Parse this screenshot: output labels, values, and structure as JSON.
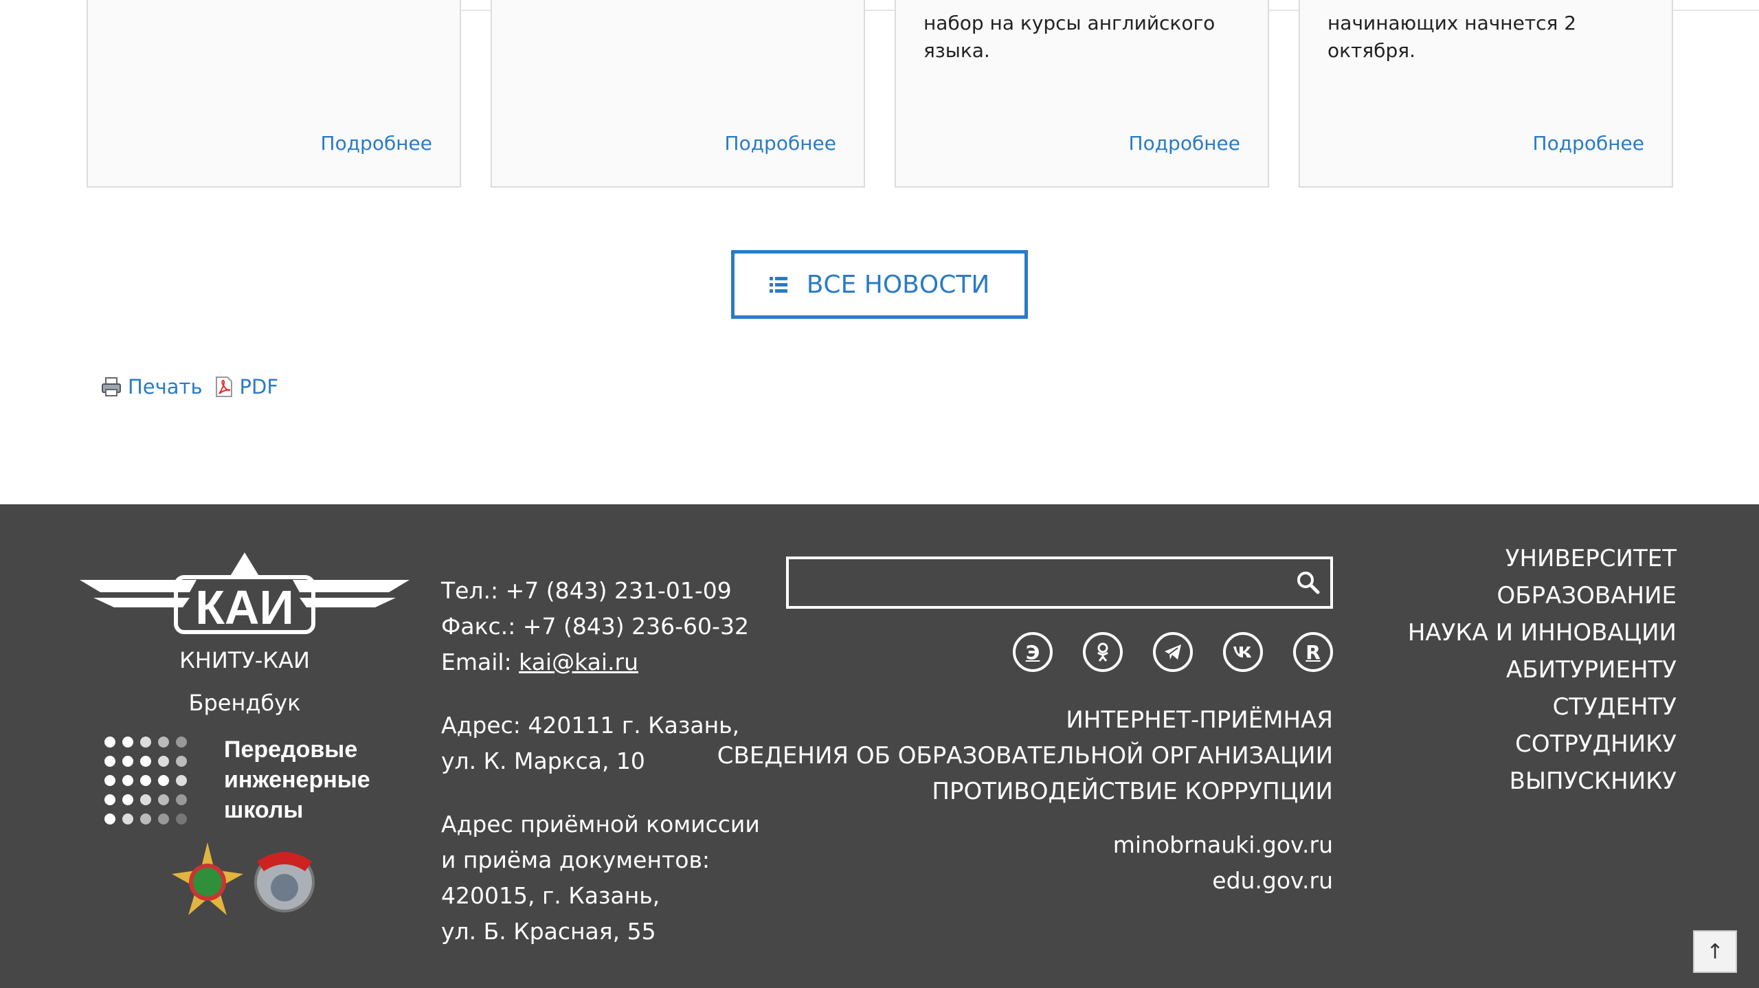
{
  "news": [
    {
      "excerpt": "",
      "more": "Подробнее"
    },
    {
      "excerpt": "",
      "more": "Подробнее"
    },
    {
      "excerpt": "набор на курсы английского языка.",
      "more": "Подробнее"
    },
    {
      "excerpt": "начинающих начнется 2 октября.",
      "more": "Подробнее"
    }
  ],
  "all_news_label": "ВСЕ НОВОСТИ",
  "print": {
    "print_label": "Печать",
    "pdf_label": "PDF"
  },
  "footer": {
    "logo_text": "КАИ",
    "org_name": "КНИТУ-КАИ",
    "brandbook": "Брендбук",
    "pis_text": [
      "Передовые",
      "инженерные",
      "школы"
    ],
    "contacts": {
      "phone": "Тел.: +7 (843) 231-01-09",
      "fax": "Факс.: +7 (843) 236-60-32",
      "email_label": "Email: ",
      "email": "kai@kai.ru",
      "address_1": "Адрес: 420111 г. Казань,",
      "address_2": "ул. К. Маркса, 10",
      "admission_1": "Адрес приёмной комиссии",
      "admission_2": "и приёма документов:",
      "admission_3": "420015, г. Казань,",
      "admission_4": "ул. Б. Красная, 55"
    },
    "search_placeholder": "",
    "socials": [
      "Э",
      "ok-icon",
      "telegram-icon",
      "vk-icon",
      "R"
    ],
    "mid_links": [
      "ИНТЕРНЕТ-ПРИЁМНАЯ",
      "СВЕДЕНИЯ ОБ ОБРАЗОВАТЕЛЬНОЙ ОРГАНИЗАЦИИ",
      "ПРОТИВОДЕЙСТВИЕ КОРРУПЦИИ"
    ],
    "sites": [
      "minobrnauki.gov.ru",
      "edu.gov.ru"
    ],
    "menu": [
      "УНИВЕРСИТЕТ",
      "ОБРАЗОВАНИЕ",
      "НАУКА И ИННОВАЦИИ",
      "АБИТУРИЕНТУ",
      "СТУДЕНТУ",
      "СОТРУДНИКУ",
      "ВЫПУСКНИКУ"
    ]
  },
  "to_top_label": "↑",
  "colors": {
    "accent": "#2a7bc6",
    "footer_bg": "#474747"
  }
}
